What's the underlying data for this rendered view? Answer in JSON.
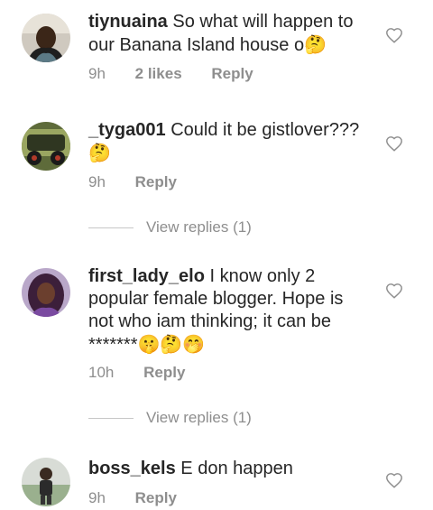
{
  "comments": [
    {
      "username": "tiynuaina",
      "text": "So what will happen to our Banana Island house o",
      "emoji": "🤔",
      "time": "9h",
      "likes": "2 likes",
      "reply": "Reply"
    },
    {
      "username": "_tyga001",
      "text": "Could it be gistlover???",
      "emoji": "🤔",
      "time": "9h",
      "reply": "Reply",
      "view_replies": "View replies (1)"
    },
    {
      "username": "first_lady_elo",
      "text": "I know only 2 popular female blogger. Hope is not who iam thinking; it can be *******",
      "emoji": "🤫🤔🤭",
      "time": "10h",
      "reply": "Reply",
      "view_replies": "View replies (1)"
    },
    {
      "username": "boss_kels",
      "text": "E don happen",
      "emoji": "",
      "time": "9h",
      "reply": "Reply"
    }
  ],
  "icons": {
    "like": "heart-outline-icon"
  },
  "colors": {
    "text": "#262626",
    "meta": "#8e8e8e",
    "divider": "#c7c7c7"
  }
}
